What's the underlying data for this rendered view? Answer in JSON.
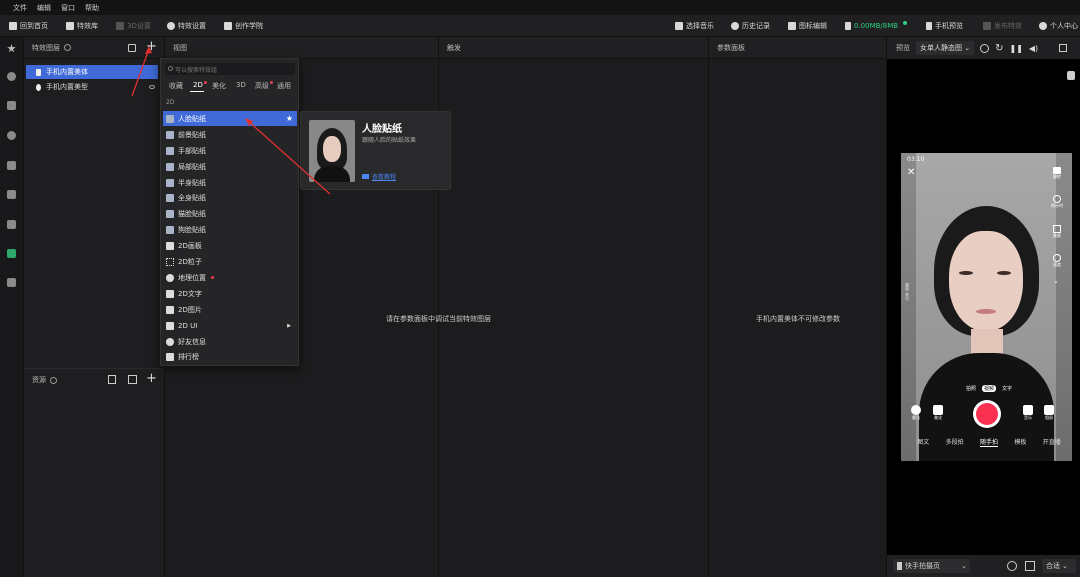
{
  "menu": [
    "文件",
    "编辑",
    "窗口",
    "帮助"
  ],
  "toolbar": {
    "home": "回到首页",
    "effects_lib": "特效库",
    "settings_3d": "3D设置",
    "effect_settings": "特效设置",
    "academy": "创作学院",
    "music": "选择音乐",
    "history": "历史记录",
    "icon_edit": "图标编辑",
    "memory": "0.00MB/8MB",
    "phone_preview": "手机预览",
    "publish": "发布特效",
    "profile": "个人中心"
  },
  "layers": {
    "title": "特效图层",
    "items": [
      {
        "label": "手机内置美体",
        "selected": true
      },
      {
        "label": "手机内置美型",
        "selected": false
      }
    ]
  },
  "assets": {
    "title": "资源"
  },
  "columns": {
    "view": "视图",
    "trigger": "触发",
    "params": "参数面板"
  },
  "dropdown": {
    "search_placeholder": "可以搜索特效组",
    "tabs": [
      "收藏",
      "2D",
      "美化",
      "3D",
      "高级",
      "通用"
    ],
    "section": "2D",
    "items": [
      {
        "label": "人脸贴纸",
        "selected": true
      },
      {
        "label": "前景贴纸"
      },
      {
        "label": "手部贴纸"
      },
      {
        "label": "局部贴纸"
      },
      {
        "label": "半身贴纸"
      },
      {
        "label": "全身贴纸"
      },
      {
        "label": "猫脸贴纸"
      },
      {
        "label": "狗脸贴纸"
      },
      {
        "label": "2D画板"
      },
      {
        "label": "2D粒子"
      },
      {
        "label": "地理位置"
      },
      {
        "label": "2D文字"
      },
      {
        "label": "2D图片"
      },
      {
        "label": "2D UI"
      },
      {
        "label": "好友信息"
      },
      {
        "label": "排行榜"
      }
    ]
  },
  "card": {
    "title": "人脸贴纸",
    "desc": "跟随人脸的贴纸效果",
    "link": "查看教程"
  },
  "messages": {
    "trigger_center": "请在参数面板中调试当前特效图层",
    "params_center": "手机内置美体不可修改参数"
  },
  "preview": {
    "label": "预览",
    "model": "女单人静态图",
    "footer_select": "快手拍摄页",
    "fit": "合适",
    "phone": {
      "time": "03:10",
      "right_icons": [
        "翻转",
        "倒计时",
        "美颜",
        "速度"
      ],
      "left_text": "魔表 美化",
      "modes_top": [
        "拍照",
        "视频",
        "文字"
      ],
      "bottom_left": [
        "魔法",
        "美化"
      ],
      "bottom_right": [
        "音乐",
        "相册"
      ],
      "modes": [
        "图文",
        "多段拍",
        "随手拍",
        "模板",
        "开直播"
      ]
    }
  }
}
